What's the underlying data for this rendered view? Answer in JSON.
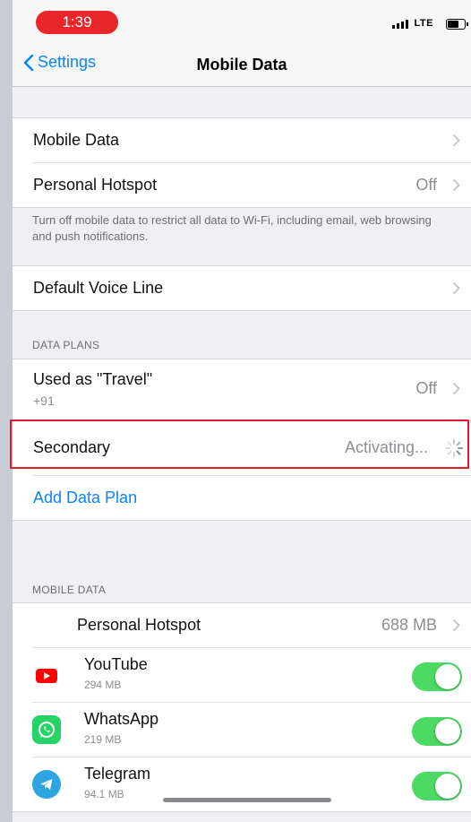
{
  "status_bar": {
    "time": "1:39",
    "network": "LTE"
  },
  "nav": {
    "back_label": "Settings",
    "title": "Mobile Data"
  },
  "group1": {
    "mobile_data": {
      "label": "Mobile Data"
    },
    "personal_hotspot": {
      "label": "Personal Hotspot",
      "value": "Off"
    }
  },
  "note": "Turn off mobile data to restrict all data to Wi-Fi, including email, web browsing and push notifications.",
  "group2": {
    "default_voice_line": {
      "label": "Default Voice Line"
    }
  },
  "data_plans": {
    "header": "DATA PLANS",
    "travel": {
      "label": "Used as \"Travel\"",
      "sub": "+91",
      "value": "Off"
    },
    "secondary": {
      "label": "Secondary",
      "value": "Activating..."
    },
    "add": {
      "label": "Add Data Plan"
    }
  },
  "mobile_data_section": {
    "header": "MOBILE DATA",
    "hotspot": {
      "label": "Personal Hotspot",
      "value": "688 MB"
    },
    "apps": [
      {
        "name": "YouTube",
        "size": "294 MB",
        "enabled": true
      },
      {
        "name": "WhatsApp",
        "size": "219 MB",
        "enabled": true
      },
      {
        "name": "Telegram",
        "size": "94.1 MB",
        "enabled": true
      }
    ]
  },
  "colors": {
    "accent": "#0a84ff",
    "toggle_on": "#4cd964",
    "highlight": "#e3192d",
    "time_pill": "#e8262b"
  },
  "icons": {
    "youtube": "youtube-icon",
    "whatsapp": "whatsapp-icon",
    "telegram": "telegram-icon"
  }
}
